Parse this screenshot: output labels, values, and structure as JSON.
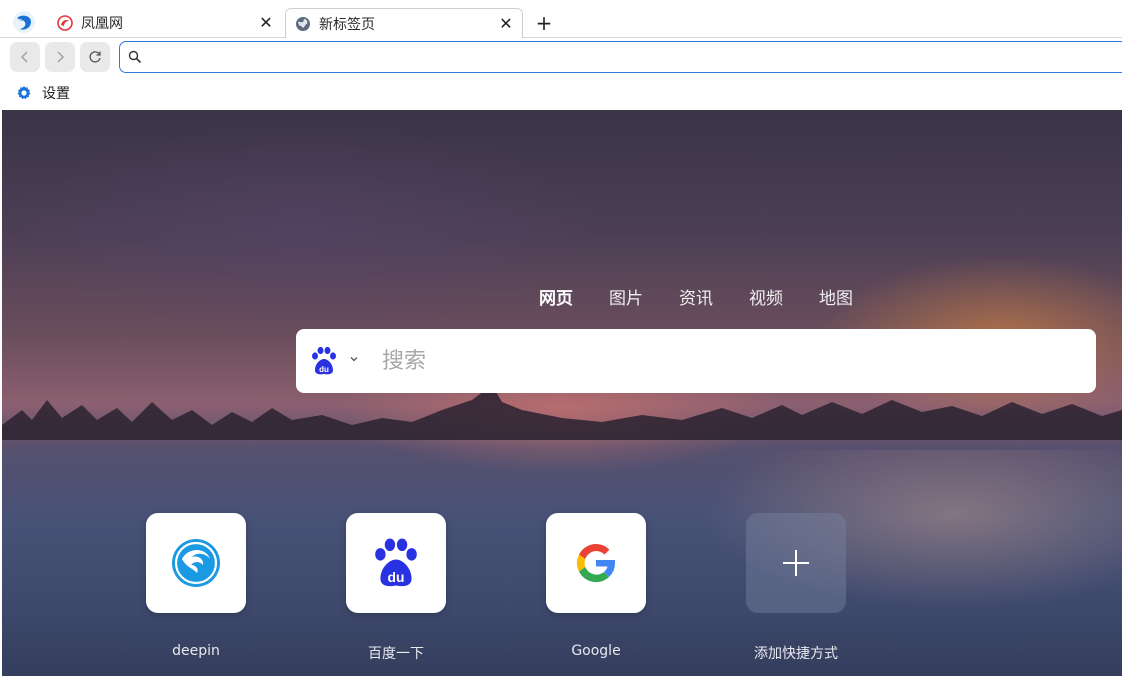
{
  "tabs": [
    {
      "title": "凤凰网",
      "icon": "ifeng-icon",
      "active": false
    },
    {
      "title": "新标签页",
      "icon": "globe-icon",
      "active": true
    }
  ],
  "new_tab_label": "+",
  "close_label": "✕",
  "toolbar": {
    "back_label": "‹",
    "forward_label": "›",
    "reload_label": "⟳",
    "address_value": "",
    "address_placeholder": ""
  },
  "bookmarks": [
    {
      "label": "设置",
      "icon": "gear-icon"
    }
  ],
  "newtab": {
    "search_tabs": [
      "网页",
      "图片",
      "资讯",
      "视频",
      "地图"
    ],
    "active_search_tab": "网页",
    "search_engine_icon": "baidu-icon",
    "search_placeholder": "搜索",
    "search_value": "",
    "shortcuts": [
      {
        "label": "deepin",
        "icon": "deepin-icon"
      },
      {
        "label": "百度一下",
        "icon": "baidu-icon"
      },
      {
        "label": "Google",
        "icon": "google-icon"
      },
      {
        "label": "添加快捷方式",
        "icon": "plus-icon"
      }
    ]
  },
  "colors": {
    "accent": "#2f7bdd",
    "baidu_blue": "#2932e1",
    "deepin_blue": "#1b9ae4"
  }
}
